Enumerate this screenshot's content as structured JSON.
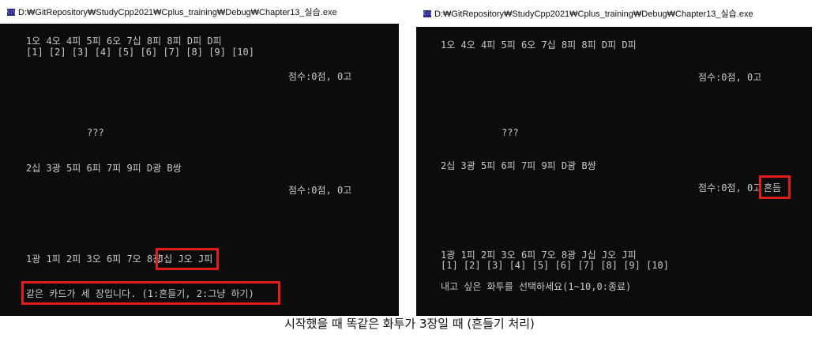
{
  "left_window": {
    "title": "D:₩GitRepository₩StudyCpp2021₩Cplus_training₩Debug₩Chapter13_실습.exe",
    "lines": {
      "player_cards": "1오 4오 4피 5피 6오 7십 8피 8피 D피 D피",
      "player_indices": "[1] [2] [3] [4] [5] [6] [7] [8] [9] [10]",
      "player_score": "점수:0점, 0고",
      "deck": "???",
      "field_cards": "2십 3광 5피 6피 7피 9피 D광 B쌍",
      "computer_score": "점수:0점, 0고",
      "computer_cards_prefix": "1광 1피 2피 3오 6피 7오 8광",
      "computer_cards_highlight": "J십 J오 J피",
      "prompt": "같은 카드가 세 장입니다. (1:흔들기, 2:그냥 하기)"
    }
  },
  "right_window": {
    "title": "D:₩GitRepository₩StudyCpp2021₩Cplus_training₩Debug₩Chapter13_실습.exe",
    "lines": {
      "top_cards": "1오 4오 4피 5피 6오 7십 8피 8피 D피 D피",
      "top_score": "점수:0점, 0고",
      "deck": "???",
      "field_cards": "2십 3광 5피 6피 7피 9피 D광 B쌍",
      "mid_score": "점수:0점, 0고",
      "shake_label": "흔듬",
      "hand_cards": "1광 1피 2피 3오 6피 7오 8광 J십 J오 J피",
      "hand_indices": "[1] [2] [3] [4] [5] [6] [7] [8] [9] [10]",
      "prompt": "내고 싶은 화투를 선택하세요(1~10,0:종료)"
    }
  },
  "caption": "시작했을 때 똑같은 화투가 3장일 때 (흔들기 처리)",
  "colors": {
    "console_bg": "#0c0c0c",
    "console_text": "#c8c8c8",
    "highlight": "#e21b1b"
  },
  "icons": {
    "app": "console-app-icon"
  }
}
